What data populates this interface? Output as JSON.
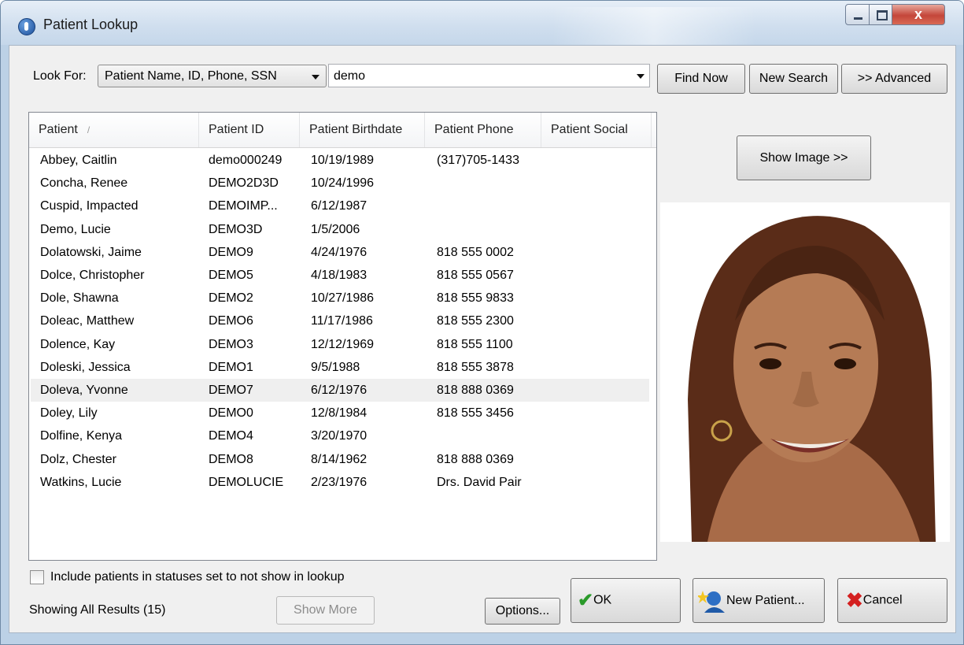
{
  "window": {
    "title": "Patient Lookup"
  },
  "search": {
    "look_for_label": "Look For:",
    "type_selected": "Patient Name, ID, Phone, SSN",
    "query": "demo",
    "find_now": "Find Now",
    "new_search": "New Search",
    "advanced": ">> Advanced"
  },
  "table": {
    "columns": [
      "Patient",
      "Patient ID",
      "Patient Birthdate",
      "Patient Phone",
      "Patient Social"
    ],
    "sort_indicator": "/",
    "rows": [
      {
        "name": "Abbey, Caitlin",
        "id": "demo000249",
        "birthdate": "10/19/1989",
        "phone": "(317)705-1433",
        "social": ""
      },
      {
        "name": "Concha, Renee",
        "id": "DEMO2D3D",
        "birthdate": "10/24/1996",
        "phone": "",
        "social": ""
      },
      {
        "name": "Cuspid, Impacted",
        "id": "DEMOIMP...",
        "birthdate": "6/12/1987",
        "phone": "",
        "social": ""
      },
      {
        "name": "Demo, Lucie",
        "id": "DEMO3D",
        "birthdate": "1/5/2006",
        "phone": "",
        "social": ""
      },
      {
        "name": "Dolatowski, Jaime",
        "id": "DEMO9",
        "birthdate": "4/24/1976",
        "phone": "818 555 0002",
        "social": ""
      },
      {
        "name": "Dolce, Christopher",
        "id": "DEMO5",
        "birthdate": "4/18/1983",
        "phone": "818 555 0567",
        "social": ""
      },
      {
        "name": "Dole, Shawna",
        "id": "DEMO2",
        "birthdate": "10/27/1986",
        "phone": "818 555 9833",
        "social": ""
      },
      {
        "name": "Doleac, Matthew",
        "id": "DEMO6",
        "birthdate": "11/17/1986",
        "phone": "818 555 2300",
        "social": ""
      },
      {
        "name": "Dolence, Kay",
        "id": "DEMO3",
        "birthdate": "12/12/1969",
        "phone": "818 555 1100",
        "social": ""
      },
      {
        "name": "Doleski, Jessica",
        "id": "DEMO1",
        "birthdate": "9/5/1988",
        "phone": "818 555 3878",
        "social": ""
      },
      {
        "name": "Doleva, Yvonne",
        "id": "DEMO7",
        "birthdate": "6/12/1976",
        "phone": "818 888 0369",
        "social": ""
      },
      {
        "name": "Doley, Lily",
        "id": "DEMO0",
        "birthdate": "12/8/1984",
        "phone": "818 555 3456",
        "social": ""
      },
      {
        "name": "Dolfine, Kenya",
        "id": "DEMO4",
        "birthdate": "3/20/1970",
        "phone": "",
        "social": ""
      },
      {
        "name": "Dolz, Chester",
        "id": "DEMO8",
        "birthdate": "8/14/1962",
        "phone": "818 888 0369",
        "social": ""
      },
      {
        "name": "Watkins, Lucie",
        "id": "DEMOLUCIE",
        "birthdate": "2/23/1976",
        "phone": "Drs. David Pair",
        "social": ""
      }
    ],
    "selected_index": 10
  },
  "image_panel": {
    "show_image": "Show Image >>"
  },
  "footer": {
    "include_label": "Include patients in statuses set to not show in lookup",
    "include_checked": false,
    "showing": "Showing All Results (15)",
    "show_more": "Show More",
    "options": "Options...",
    "ok": "OK",
    "new_patient": "New Patient...",
    "cancel": "Cancel"
  },
  "icons": {
    "app": "app-icon",
    "ok": "green-checkmark-icon",
    "new_patient": "new-patient-icon",
    "cancel": "red-x-icon"
  },
  "colors": {
    "titlebar": "#cfdeee",
    "client": "#f0f0f0",
    "selected_row": "#efefef"
  }
}
